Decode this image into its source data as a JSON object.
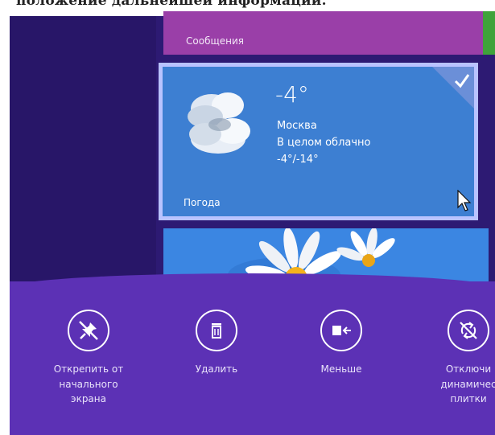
{
  "caption": "положение дальнейшей информации.",
  "tiles": {
    "messages": {
      "label": "Сообщения"
    },
    "weather": {
      "label": "Погода",
      "temperature": "-4°",
      "city": "Москва",
      "condition": "В целом облачно",
      "range": "-4°/-14°",
      "selected": true
    }
  },
  "appbar": {
    "commands": [
      {
        "label": "Открепить от\nначального\nэкрана",
        "icon": "unpin-icon"
      },
      {
        "label": "Удалить",
        "icon": "trash-icon"
      },
      {
        "label": "Меньше",
        "icon": "resize-smaller-icon"
      },
      {
        "label": "Отключи\nдинамичес\nплитки",
        "icon": "live-tile-off-icon"
      }
    ]
  },
  "colors": {
    "start_background": "#2d1a73",
    "messages_tile": "#9a3fa8",
    "weather_tile": "#3d7fd2",
    "appbar": "#5c31b5"
  }
}
